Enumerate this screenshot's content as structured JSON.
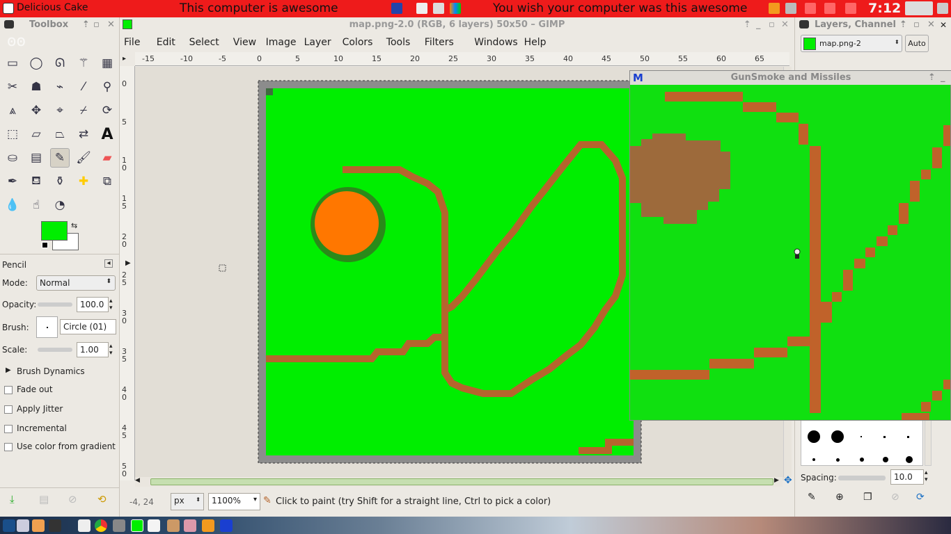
{
  "top_panel": {
    "brand": "Delicious Cake",
    "message_left": "This computer is awesome",
    "message_right": "You wish your computer was this awesome",
    "clock": "7:12"
  },
  "toolbox": {
    "title": "Toolbox",
    "tool_options_title": "Pencil",
    "mode_label": "Mode:",
    "mode_value": "Normal",
    "opacity_label": "Opacity:",
    "opacity_value": "100.0",
    "brush_label": "Brush:",
    "brush_value": "Circle (01)",
    "scale_label": "Scale:",
    "scale_value": "1.00",
    "brush_dynamics": "Brush Dynamics",
    "fade_out": "Fade out",
    "apply_jitter": "Apply Jitter",
    "incremental": "Incremental",
    "use_color_gradient": "Use color from gradient",
    "fg_color": "#00ee00",
    "bg_color": "#ffffff",
    "tools": [
      "rect-select-icon",
      "ellipse-select-icon",
      "lasso-icon",
      "fuzzy-select-icon",
      "color-select-icon",
      "scissors-icon",
      "foreground-select-icon",
      "paths-icon",
      "color-picker-icon",
      "zoom-icon",
      "measure-icon",
      "move-icon",
      "align-icon",
      "crop-icon",
      "rotate-icon",
      "scale-icon",
      "shear-icon",
      "perspective-icon",
      "flip-icon",
      "text-icon",
      "bucket-fill-icon",
      "blend-icon",
      "pencil-icon",
      "paintbrush-icon",
      "eraser-icon",
      "airbrush-icon",
      "ink-icon",
      "clone-icon",
      "heal-icon",
      "perspective-clone-icon",
      "blur-icon",
      "smudge-icon",
      "dodge-burn-icon"
    ]
  },
  "gimp": {
    "window_title": "map.png-2.0 (RGB, 6 layers) 50x50 – GIMP",
    "menu": [
      "File",
      "Edit",
      "Select",
      "View",
      "Image",
      "Layer",
      "Colors",
      "Tools",
      "Filters",
      "Windows",
      "Help"
    ],
    "hruler_ticks": [
      "-15",
      "-10",
      "-5",
      "0",
      "5",
      "10",
      "15",
      "20",
      "25",
      "30",
      "35",
      "40",
      "45",
      "50",
      "55",
      "60",
      "65"
    ],
    "vruler_ticks": [
      "0",
      "5",
      "1 0",
      "1 5",
      "2 0",
      "2 5",
      "3 0",
      "3 5",
      "4 0",
      "4 5",
      "5 0"
    ],
    "status": {
      "coords": "-4, 24",
      "unit": "px",
      "zoom": "1100%",
      "message": "Click to paint (try Shift for a straight line, Ctrl to pick a color)"
    }
  },
  "right_dock": {
    "title": "Layers, Channel",
    "image_name": "map.png-2",
    "auto_label": "Auto",
    "spacing_label": "Spacing:",
    "spacing_value": "10.0"
  },
  "gunsmoke": {
    "title": "GunSmoke and Missiles",
    "app_icon": "M"
  },
  "colors": {
    "grass": "#00ee00",
    "road": "#b5652d",
    "pond": "#ff7700",
    "panel_red": "#ee1b1b"
  }
}
